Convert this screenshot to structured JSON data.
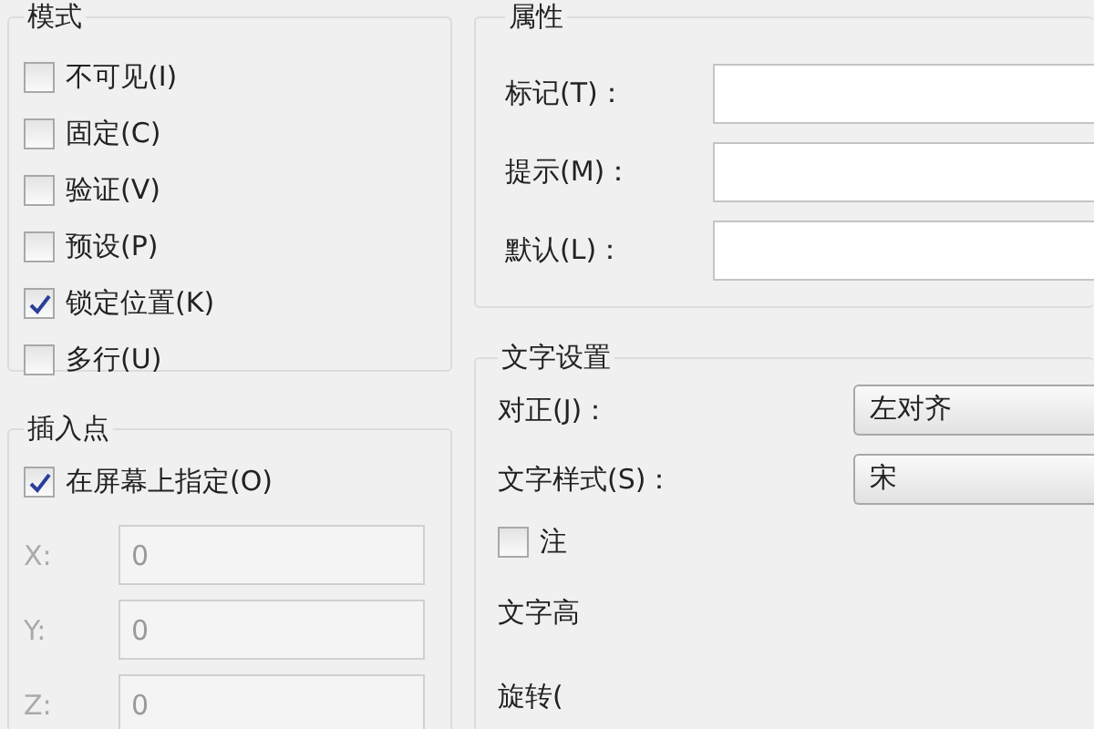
{
  "mode": {
    "title": "模式",
    "options": [
      {
        "label": "不可见(I)",
        "checked": false
      },
      {
        "label": "固定(C)",
        "checked": false
      },
      {
        "label": "验证(V)",
        "checked": false
      },
      {
        "label": "预设(P)",
        "checked": false
      },
      {
        "label": "锁定位置(K)",
        "checked": true
      },
      {
        "label": "多行(U)",
        "checked": false
      }
    ]
  },
  "insertion_point": {
    "title": "插入点",
    "specify_on_screen": {
      "label": "在屏幕上指定(O)",
      "checked": true
    },
    "coordinates": [
      {
        "label": "X:",
        "value": "0",
        "disabled": true
      },
      {
        "label": "Y:",
        "value": "0",
        "disabled": true
      },
      {
        "label": "Z:",
        "value": "0",
        "disabled": true
      }
    ]
  },
  "attribute": {
    "title": "属性",
    "fields": [
      {
        "label": "标记(T)："
      },
      {
        "label": "提示(M)："
      },
      {
        "label": "默认(L)："
      }
    ]
  },
  "text_settings": {
    "title": "文字设置",
    "rows": [
      {
        "kind": "dropdown",
        "label": "对正(J)：",
        "value": "左对齐"
      },
      {
        "kind": "dropdown",
        "label": "文字样式(S)：",
        "value": "宋"
      },
      {
        "kind": "checkbox",
        "label": "注",
        "checked": false
      },
      {
        "kind": "label",
        "label": "文字高"
      },
      {
        "kind": "label",
        "label": "旋转("
      }
    ]
  }
}
